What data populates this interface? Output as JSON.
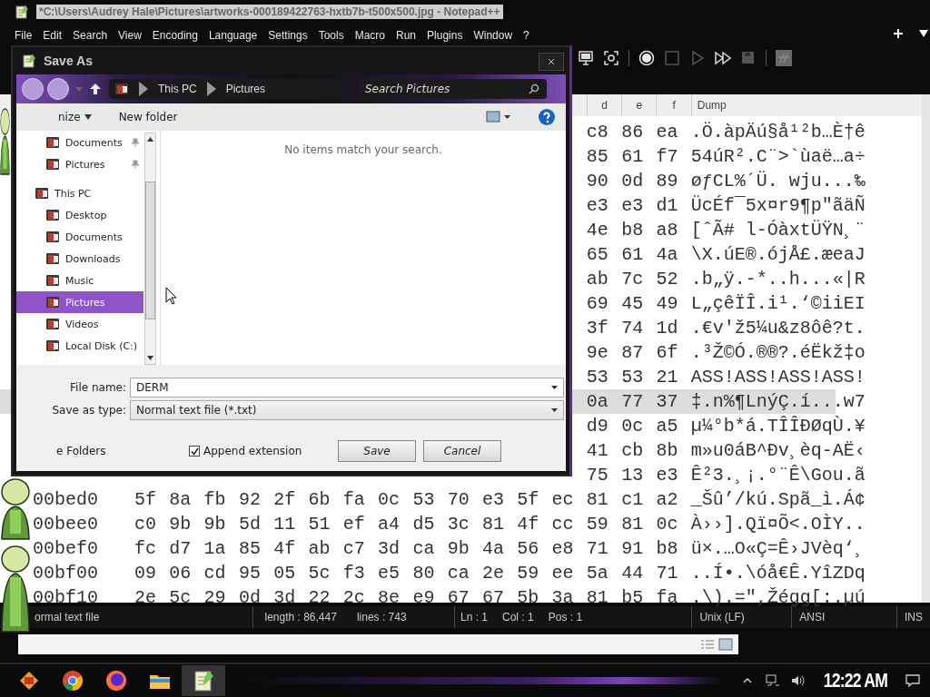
{
  "window": {
    "title": "*C:\\Users\\Audrey Hale\\Pictures\\artworks-000189422763-hxtb7b-t500x500.jpg - Notepad++"
  },
  "menu": [
    "File",
    "Edit",
    "Search",
    "View",
    "Encoding",
    "Language",
    "Settings",
    "Tools",
    "Macro",
    "Run",
    "Plugins",
    "Window",
    "?"
  ],
  "hex_view": {
    "columns": [
      "d",
      "e",
      "f"
    ],
    "dump_label": "Dump",
    "rows": [
      {
        "bytes": [
          "c8",
          "86",
          "ea"
        ],
        "dump": ".Ö.àpÄú§å¹²b…È†ê",
        "selected": false
      },
      {
        "bytes": [
          "85",
          "61",
          "f7"
        ],
        "dump": "54úR².C¨>`ùaë…a÷",
        "selected": false
      },
      {
        "bytes": [
          "90",
          "0d",
          "89"
        ],
        "dump": "øƒCL%´Ü. wju...‰",
        "selected": false
      },
      {
        "bytes": [
          "e3",
          "e3",
          "d1"
        ],
        "dump": "ÜcÉf¯5x¤r9¶p\"ãäÑ",
        "selected": false
      },
      {
        "bytes": [
          "4e",
          "b8",
          "a8"
        ],
        "dump": "[ˆÃ# l-ÓàxtÜŸN¸¨",
        "selected": false
      },
      {
        "bytes": [
          "65",
          "61",
          "4a"
        ],
        "dump": "\\X.úE®.ójÅ£.æeaJ",
        "selected": false
      },
      {
        "bytes": [
          "ab",
          "7c",
          "52"
        ],
        "dump": ".b„ÿ.-*..h...«|R",
        "selected": false
      },
      {
        "bytes": [
          "69",
          "45",
          "49"
        ],
        "dump": "L„çêÏÎ.i¹.‘©iiEI",
        "selected": false
      },
      {
        "bytes": [
          "3f",
          "74",
          "1d"
        ],
        "dump": ".€v'ž5¼u&z8ôê?t.",
        "selected": false
      },
      {
        "bytes": [
          "9e",
          "87",
          "6f"
        ],
        "dump": ".³Ž©Ó.®®?.éËkž‡o",
        "selected": false
      },
      {
        "bytes": [
          "53",
          "53",
          "21"
        ],
        "dump": "ASS!ASS!ASS!ASS!",
        "selected": false
      },
      {
        "bytes": [
          "0a",
          "77",
          "37"
        ],
        "dump": "‡.n%¶LnýÇ.í...w7",
        "selected": true
      },
      {
        "bytes": [
          "d9",
          "0c",
          "a5"
        ],
        "dump": "µ¼°b*á.TÎÎÐØqÙ.¥",
        "selected": false
      },
      {
        "bytes": [
          "41",
          "cb",
          "8b"
        ],
        "dump": "m»u0áB^Ðv¸èq-AË‹",
        "selected": false
      },
      {
        "bytes": [
          "75",
          "13",
          "e3"
        ],
        "dump": "Ê²3.¸¡.°¨Ê\\Gou.ã",
        "selected": false
      },
      {
        "address": "00bed0",
        "bytes": [
          "5f",
          "8a",
          "fb",
          "92",
          "2f",
          "6b",
          "fa",
          "0c",
          "53",
          "70",
          "e3",
          "5f",
          "ec",
          "81",
          "c1",
          "a2"
        ],
        "dump": "_Šû’/kú.Spã_ì.Á¢",
        "selected": false
      },
      {
        "address": "00bee0",
        "bytes": [
          "c0",
          "9b",
          "9b",
          "5d",
          "11",
          "51",
          "ef",
          "a4",
          "d5",
          "3c",
          "81",
          "4f",
          "cc",
          "59",
          "81",
          "0c"
        ],
        "dump": "À››].Qï¤Õ<.OÌY..",
        "selected": false
      },
      {
        "address": "00bef0",
        "bytes": [
          "fc",
          "d7",
          "1a",
          "85",
          "4f",
          "ab",
          "c7",
          "3d",
          "ca",
          "9b",
          "4a",
          "56",
          "e8",
          "71",
          "91",
          "b8"
        ],
        "dump": "ü×.…O«Ç=Ê›JVèq‘¸",
        "selected": false
      },
      {
        "address": "00bf00",
        "bytes": [
          "09",
          "06",
          "cd",
          "95",
          "05",
          "5c",
          "f3",
          "e5",
          "80",
          "ca",
          "2e",
          "59",
          "ee",
          "5a",
          "44",
          "71"
        ],
        "dump": "..Í•.\\óå€Ê.YîZDq",
        "selected": false
      },
      {
        "address": "00bf10",
        "bytes": [
          "2e",
          "5c",
          "29",
          "0d",
          "3d",
          "22",
          "2c",
          "8e",
          "e9",
          "67",
          "67",
          "5b",
          "3a",
          "81",
          "b5",
          "fa"
        ],
        "dump": ".\\).=\",Žégg[:.µú",
        "selected": false
      }
    ]
  },
  "status_bar": {
    "type": "ormal text file",
    "length": "length : 86,447",
    "lines": "lines : 743",
    "ln": "Ln : 1",
    "col": "Col : 1",
    "pos": "Pos : 1",
    "eol": "Unix (LF)",
    "encoding": "ANSI",
    "mode": "INS"
  },
  "save_dialog": {
    "title": "Save As",
    "breadcrumb": [
      "This PC",
      "Pictures"
    ],
    "search": {
      "placeholder": "Search Pictures"
    },
    "organize": "nize",
    "new_folder": "New folder",
    "quick_access": [
      {
        "label": "Documents",
        "selected": false
      },
      {
        "label": "Pictures",
        "selected": false
      }
    ],
    "this_pc": {
      "label": "This PC",
      "selected": false,
      "children": [
        {
          "label": "Desktop",
          "selected": false
        },
        {
          "label": "Documents",
          "selected": false
        },
        {
          "label": "Downloads",
          "selected": false
        },
        {
          "label": "Music",
          "selected": false
        },
        {
          "label": "Pictures",
          "selected": true
        },
        {
          "label": "Videos",
          "selected": false
        },
        {
          "label": "Local Disk (C:)",
          "selected": false
        }
      ]
    },
    "empty_message": "No items match your search.",
    "file_name": {
      "label": "File name:",
      "value": "DERM"
    },
    "save_type": {
      "label": "Save as type:",
      "value": "Normal text file (*.txt)"
    },
    "hide_folders": "e Folders",
    "append_extension": {
      "label": "Append extension",
      "checked": true
    },
    "buttons": [
      "Save",
      "Cancel"
    ]
  },
  "taskbar": {
    "clock": "12:22 AM"
  }
}
